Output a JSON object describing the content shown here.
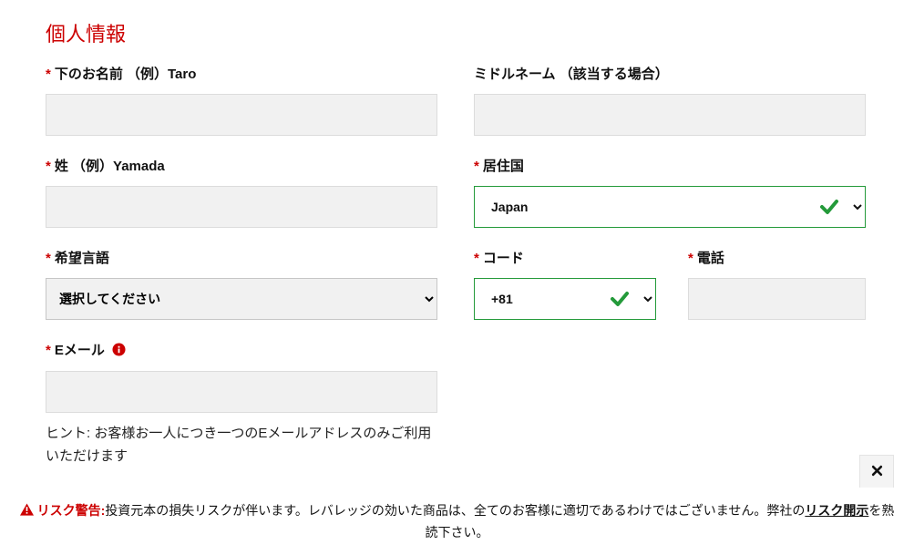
{
  "section_title": "個人情報",
  "fields": {
    "first_name": {
      "label": "下のお名前 （例）Taro",
      "required": true,
      "value": ""
    },
    "middle_name": {
      "label": "ミドルネーム （該当する場合）",
      "required": false,
      "value": ""
    },
    "last_name": {
      "label": "姓 （例）Yamada",
      "required": true,
      "value": ""
    },
    "country": {
      "label": "居住国",
      "required": true,
      "selected": "Japan",
      "options": [
        "Japan"
      ]
    },
    "language": {
      "label": "希望言語",
      "required": true,
      "selected": "選択してください",
      "options": [
        "選択してください"
      ]
    },
    "code": {
      "label": "コード",
      "required": true,
      "selected": "+81",
      "options": [
        "+81"
      ]
    },
    "phone": {
      "label": "電話",
      "required": true,
      "value": ""
    },
    "email": {
      "label": "Eメール",
      "required": true,
      "value": ""
    }
  },
  "email_hint": "ヒント: お客様お一人につき一つのEメールアドレスのみご利用いただけます",
  "risk": {
    "label": "リスク警告:",
    "text1": "投資元本の損失リスクが伴います。レバレッジの効いた商品は、全てのお客様に適切であるわけではございません。弊社の",
    "link": "リスク開示",
    "text2": "を熟読下さい。"
  },
  "colors": {
    "accent_red": "#cc0000",
    "valid_green": "#249a3a"
  }
}
